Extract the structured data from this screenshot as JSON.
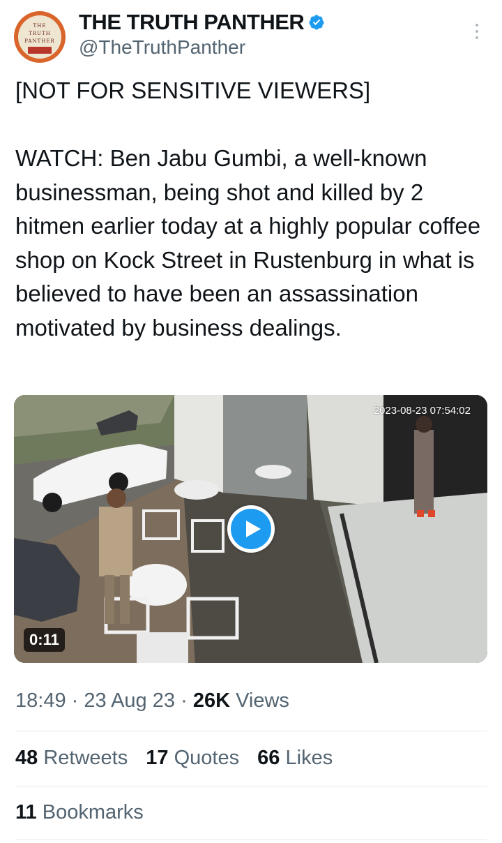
{
  "author": {
    "display_name": "THE TRUTH PANTHER",
    "handle": "@TheTruthPanther",
    "avatar_logo_lines": [
      "THE",
      "TRUTH",
      "PANTHER"
    ],
    "verified_icon": "verified-badge-icon",
    "verified_color": "#1d9bf0"
  },
  "menu": {
    "icon": "more-vertical-icon"
  },
  "tweet": {
    "paragraphs": [
      "[NOT FOR SENSITIVE VIEWERS]",
      "WATCH: Ben Jabu Gumbi, a well-known businessman, being shot and killed by 2 hitmen earlier today at a highly popular coffee shop on Kock Street in Rustenburg in what is believed to have been an assassination motivated by business dealings."
    ]
  },
  "media": {
    "cctv_timestamp": "2023-08-23 07:54:02",
    "duration": "0:11",
    "play_icon": "play-icon",
    "play_color": "#1d9bf0"
  },
  "meta": {
    "time": "18:49",
    "separator": "·",
    "date": "23 Aug 23",
    "views_count": "26K",
    "views_label": "Views"
  },
  "stats": {
    "retweets": {
      "count": "48",
      "label": "Retweets"
    },
    "quotes": {
      "count": "17",
      "label": "Quotes"
    },
    "likes": {
      "count": "66",
      "label": "Likes"
    }
  },
  "bookmarks": {
    "count": "11",
    "label": "Bookmarks"
  },
  "colors": {
    "text_primary": "#0f1419",
    "text_secondary": "#536471",
    "divider": "#e5e8eb"
  }
}
